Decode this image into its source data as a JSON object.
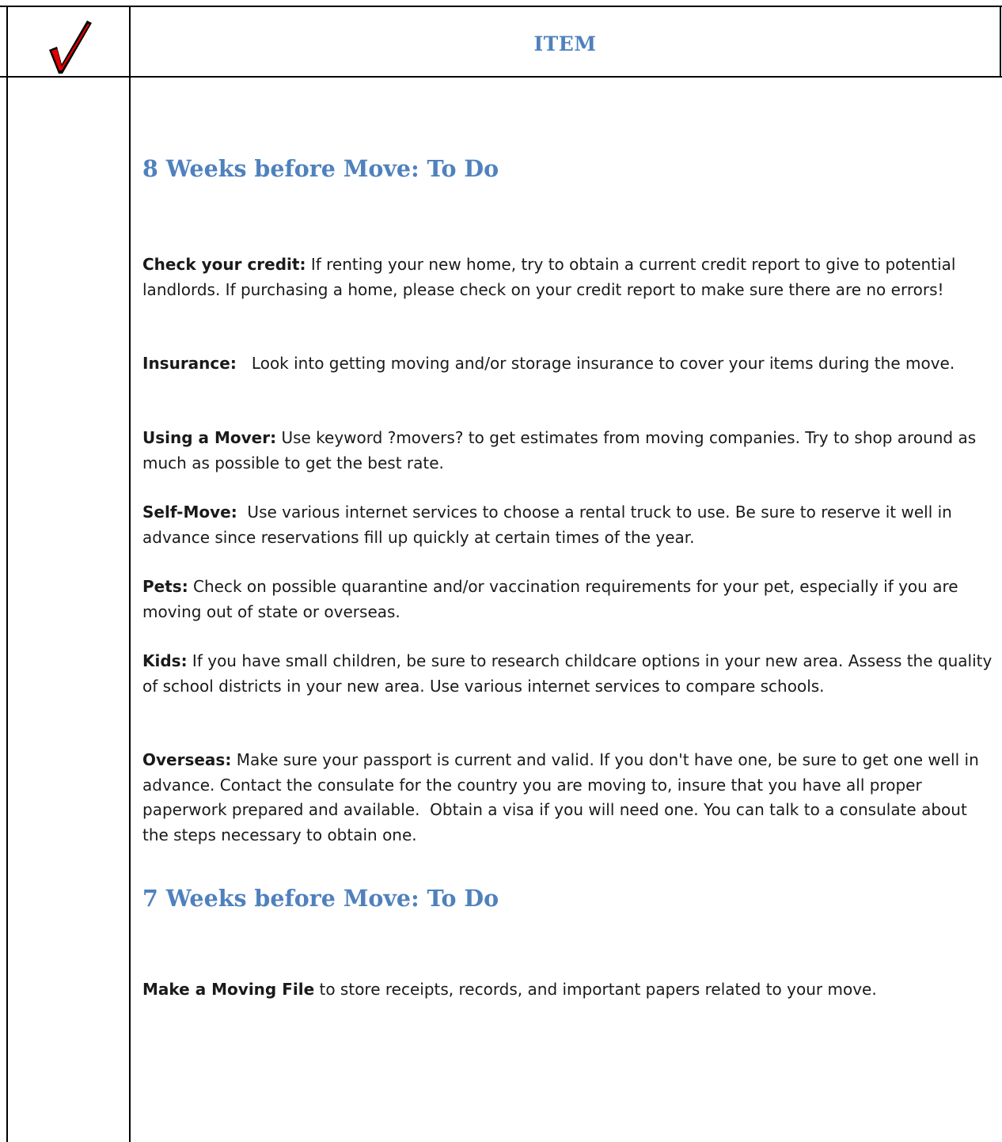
{
  "header": {
    "check_icon": "red-checkmark-icon",
    "title": "ITEM"
  },
  "sections": [
    {
      "heading": "8 Weeks before Move: To Do",
      "items": [
        {
          "label": "Check your credit:",
          "text": " If renting your new home, try to obtain a current credit report to give to potential landlords. If purchasing a home, please check on your credit report to make sure there are no errors!"
        },
        {
          "label": " Insurance:",
          "text": "   Look into getting moving and/or storage insurance to cover your items during the move."
        },
        {
          "label": "Using a Mover:",
          "text": " Use keyword ?movers? to get estimates from moving companies. Try to shop around as much as possible to get the best rate."
        },
        {
          "label": "Self-Move:",
          "text": "  Use various internet services to choose a rental truck to use. Be sure to reserve it well in advance since reservations fill up quickly at certain times of the year."
        },
        {
          "label": "Pets:",
          "text": " Check on possible quarantine and/or vaccination requirements for your pet, especially if you are moving out of state or overseas."
        },
        {
          "label": " Kids:",
          "text": " If you have small children, be sure to research childcare options in your new area. Assess the quality of school districts in your new area. Use various internet services to compare schools."
        },
        {
          "label": "Overseas:",
          "text": " Make sure your passport is current and valid. If you don't have one, be sure to get one well in advance. Contact the consulate for the country you are moving to, insure that you have all proper paperwork prepared and available.  Obtain a visa if you will need one. You can talk to a consulate about the steps necessary to obtain one."
        }
      ]
    },
    {
      "heading": "7 Weeks before Move: To Do",
      "items": [
        {
          "label": "Make a Moving File",
          "text": " to store receipts, records, and important papers related to your move."
        }
      ]
    }
  ]
}
